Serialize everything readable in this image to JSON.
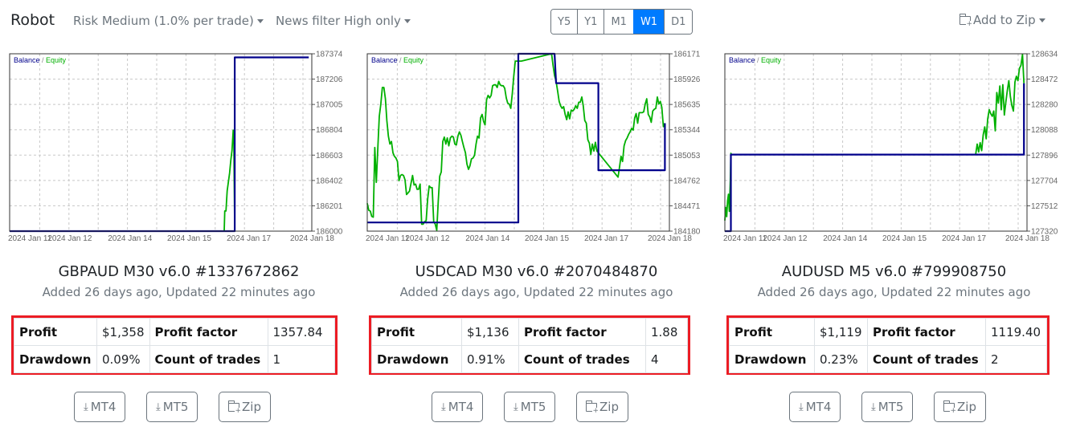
{
  "header": {
    "brand": "Robot",
    "risk_dropdown": "Risk Medium (1.0% per trade)",
    "news_dropdown": "News filter High only",
    "period_buttons": [
      {
        "label": "Y5",
        "active": false
      },
      {
        "label": "Y1",
        "active": false
      },
      {
        "label": "M1",
        "active": false
      },
      {
        "label": "W1",
        "active": true
      },
      {
        "label": "D1",
        "active": false
      }
    ],
    "add_to_zip": "Add to Zip",
    "add_to_zip_icon": "folder-plus-icon"
  },
  "colors": {
    "balance": "#00008b",
    "equity": "#00b000",
    "highlight_border": "#ec1c24",
    "active_button": "#007bff"
  },
  "cards": [
    {
      "title": "GBPAUD M30 v6.0 #1337672862",
      "subtitle": "Added 26 days ago, Updated 22 minutes ago",
      "stats": {
        "profit_label": "Profit",
        "profit": "$1,358",
        "profit_factor_label": "Profit factor",
        "profit_factor": "1357.84",
        "drawdown_label": "Drawdown",
        "drawdown": "0.09%",
        "trades_label": "Count of trades",
        "trades": "1"
      },
      "buttons": {
        "mt4": "MT4",
        "mt5": "MT5",
        "zip": "Zip"
      }
    },
    {
      "title": "USDCAD M30 v6.0 #2070484870",
      "subtitle": "Added 26 days ago, Updated 22 minutes ago",
      "stats": {
        "profit_label": "Profit",
        "profit": "$1,136",
        "profit_factor_label": "Profit factor",
        "profit_factor": "1.88",
        "drawdown_label": "Drawdown",
        "drawdown": "0.91%",
        "trades_label": "Count of trades",
        "trades": "4"
      },
      "buttons": {
        "mt4": "MT4",
        "mt5": "MT5",
        "zip": "Zip"
      }
    },
    {
      "title": "AUDUSD M5 v6.0 #799908750",
      "subtitle": "Added 26 days ago, Updated 22 minutes ago",
      "stats": {
        "profit_label": "Profit",
        "profit": "$1,119",
        "profit_factor_label": "Profit factor",
        "profit_factor": "1119.40",
        "drawdown_label": "Drawdown",
        "drawdown": "0.23%",
        "trades_label": "Count of trades",
        "trades": "2"
      },
      "buttons": {
        "mt4": "MT4",
        "mt5": "MT5",
        "zip": "Zip"
      }
    }
  ],
  "chart_data": [
    {
      "type": "line",
      "title": "",
      "legend": [
        "Balance",
        "Equity"
      ],
      "legend_position": "top-left",
      "grid": true,
      "x_tick_labels": [
        "2024 Jan 11",
        "2024 Jan 12",
        "2024 Jan 14",
        "2024 Jan 15",
        "2024 Jan 17",
        "2024 Jan 18"
      ],
      "y_tick_labels": [
        186000,
        186201,
        186402,
        186603,
        186804,
        187005,
        187206,
        187374
      ],
      "ylim": [
        186000,
        187374
      ],
      "x_unit": "fraction of visible time range",
      "series": [
        {
          "name": "Balance",
          "x": [
            0,
            0.745,
            0.745,
            0.99
          ],
          "y": [
            186000,
            186000,
            187350,
            187350
          ]
        },
        {
          "name": "Equity",
          "x": [
            0,
            0.71,
            0.712,
            0.716,
            0.72,
            0.724,
            0.728,
            0.732,
            0.736,
            0.74,
            0.742,
            0.745
          ],
          "y": [
            186000,
            186000,
            186160,
            186160,
            186320,
            186390,
            186460,
            186560,
            186640,
            186800,
            186700,
            186000
          ]
        }
      ]
    },
    {
      "type": "line",
      "title": "",
      "legend": [
        "Balance",
        "Equity"
      ],
      "legend_position": "top-left",
      "grid": true,
      "x_tick_labels": [
        "2024 Jan 11",
        "2024 Jan 12",
        "2024 Jan 14",
        "2024 Jan 15",
        "2024 Jan 17",
        "2024 Jan 18"
      ],
      "y_tick_labels": [
        184180,
        184471,
        184762,
        185053,
        185344,
        185635,
        185926,
        186171
      ],
      "ylim": [
        184180,
        186171
      ],
      "x_unit": "fraction of visible time range",
      "series": [
        {
          "name": "Balance",
          "x": [
            0,
            0.5,
            0.5,
            0.62,
            0.625,
            0.765,
            0.765,
            0.985,
            0.985
          ],
          "y": [
            184280,
            184280,
            186171,
            186171,
            185880,
            185880,
            184880,
            184880,
            185420
          ]
        },
        {
          "name": "Equity",
          "x": [
            0,
            0.005,
            0.01,
            0.015,
            0.02,
            0.025,
            0.03,
            0.035,
            0.04,
            0.045,
            0.05,
            0.055,
            0.06,
            0.065,
            0.07,
            0.075,
            0.08,
            0.085,
            0.09,
            0.095,
            0.1,
            0.105,
            0.11,
            0.115,
            0.12,
            0.125,
            0.13,
            0.135,
            0.14,
            0.15,
            0.155,
            0.16,
            0.165,
            0.17,
            0.175,
            0.18,
            0.185,
            0.19,
            0.195,
            0.2,
            0.205,
            0.21,
            0.215,
            0.22,
            0.225,
            0.23,
            0.235,
            0.24,
            0.245,
            0.25,
            0.255,
            0.26,
            0.265,
            0.27,
            0.275,
            0.28,
            0.285,
            0.29,
            0.295,
            0.3,
            0.305,
            0.31,
            0.315,
            0.32,
            0.325,
            0.33,
            0.335,
            0.34,
            0.345,
            0.35,
            0.355,
            0.36,
            0.365,
            0.37,
            0.375,
            0.38,
            0.385,
            0.39,
            0.395,
            0.4,
            0.405,
            0.41,
            0.415,
            0.42,
            0.425,
            0.43,
            0.435,
            0.44,
            0.445,
            0.45,
            0.455,
            0.46,
            0.465,
            0.47,
            0.475,
            0.48,
            0.485,
            0.49,
            0.495,
            0.5,
            0.505,
            0.51,
            0.61,
            0.615,
            0.62,
            0.625,
            0.63,
            0.635,
            0.64,
            0.645,
            0.65,
            0.655,
            0.66,
            0.665,
            0.67,
            0.675,
            0.68,
            0.685,
            0.69,
            0.695,
            0.7,
            0.705,
            0.71,
            0.715,
            0.72,
            0.725,
            0.73,
            0.735,
            0.74,
            0.745,
            0.75,
            0.755,
            0.76,
            0.83,
            0.835,
            0.84,
            0.845,
            0.85,
            0.855,
            0.86,
            0.865,
            0.87,
            0.875,
            0.88,
            0.885,
            0.89,
            0.895,
            0.9,
            0.905,
            0.91,
            0.915,
            0.92,
            0.925,
            0.93,
            0.935,
            0.94,
            0.945,
            0.95,
            0.955,
            0.96,
            0.965,
            0.97,
            0.975,
            0.98,
            0.985
          ],
          "y": [
            184500,
            184420,
            184410,
            184350,
            184340,
            185140,
            184740,
            185140,
            185500,
            185640,
            185830,
            185830,
            185700,
            185450,
            185270,
            185180,
            185210,
            185080,
            185040,
            185020,
            184980,
            184760,
            184820,
            184830,
            184820,
            184770,
            184600,
            184620,
            184640,
            184820,
            184710,
            184720,
            184660,
            184660,
            184720,
            184260,
            184260,
            184290,
            184300,
            184550,
            184700,
            184680,
            184680,
            184290,
            184260,
            184190,
            184530,
            184810,
            184860,
            185210,
            185260,
            185180,
            185250,
            185160,
            185250,
            185270,
            185260,
            185180,
            185170,
            185270,
            185320,
            185280,
            185210,
            185140,
            185080,
            184950,
            184890,
            184930,
            185010,
            185020,
            185050,
            185180,
            185270,
            185250,
            185480,
            185520,
            185440,
            185400,
            185690,
            185740,
            185710,
            185740,
            185850,
            185860,
            185860,
            185830,
            185900,
            185860,
            185850,
            185850,
            185820,
            185710,
            185650,
            185640,
            185590,
            185760,
            185960,
            186100,
            186100,
            186100,
            186100,
            186100,
            186171,
            186060,
            185960,
            185900,
            185790,
            185670,
            185620,
            185590,
            185610,
            185520,
            185460,
            185550,
            185470,
            185570,
            185560,
            185580,
            185620,
            185590,
            185660,
            185660,
            185720,
            185620,
            185450,
            185420,
            185230,
            185190,
            185060,
            185180,
            185100,
            185200,
            185100,
            184800,
            184920,
            185040,
            184980,
            185160,
            185220,
            185250,
            185290,
            185320,
            185360,
            185340,
            185480,
            185530,
            185420,
            185540,
            185540,
            185540,
            185550,
            185640,
            185700,
            185520,
            185490,
            185430,
            185560,
            185580,
            185590,
            185720,
            185640,
            185670,
            185600,
            185380,
            185420
          ]
        }
      ]
    },
    {
      "type": "line",
      "title": "",
      "legend": [
        "Balance",
        "Equity"
      ],
      "legend_position": "top-left",
      "grid": true,
      "x_tick_labels": [
        "2024 Jan 11",
        "2024 Jan 12",
        "2024 Jan 14",
        "2024 Jan 15",
        "2024 Jan 17",
        "2024 Jan 18"
      ],
      "y_tick_labels": [
        127320,
        127512,
        127704,
        127896,
        128088,
        128280,
        128472,
        128634
      ],
      "ylim": [
        127320,
        128634
      ],
      "x_unit": "fraction of visible time range",
      "series": [
        {
          "name": "Balance",
          "x": [
            0,
            0.02,
            0.02,
            0.99,
            0.99
          ],
          "y": [
            127320,
            127320,
            127900,
            127900,
            128440
          ]
        },
        {
          "name": "Equity",
          "x": [
            0,
            0.003,
            0.006,
            0.009,
            0.012,
            0.015,
            0.018,
            0.02,
            0.022,
            0.83,
            0.835,
            0.84,
            0.845,
            0.85,
            0.855,
            0.86,
            0.865,
            0.87,
            0.875,
            0.88,
            0.885,
            0.89,
            0.895,
            0.9,
            0.905,
            0.91,
            0.915,
            0.92,
            0.925,
            0.93,
            0.935,
            0.94,
            0.945,
            0.95,
            0.955,
            0.96,
            0.965,
            0.97,
            0.975,
            0.98,
            0.985,
            0.99
          ],
          "y": [
            127400,
            127500,
            127430,
            127550,
            127600,
            127470,
            127700,
            127910,
            127900,
            127900,
            127980,
            127920,
            127990,
            127930,
            128050,
            128110,
            128020,
            128170,
            128240,
            128210,
            128190,
            128230,
            128080,
            128370,
            128290,
            128420,
            128240,
            128430,
            128200,
            128300,
            128390,
            128460,
            128340,
            128270,
            128230,
            128450,
            128490,
            128460,
            128540,
            128560,
            128630,
            128440
          ]
        }
      ]
    }
  ]
}
